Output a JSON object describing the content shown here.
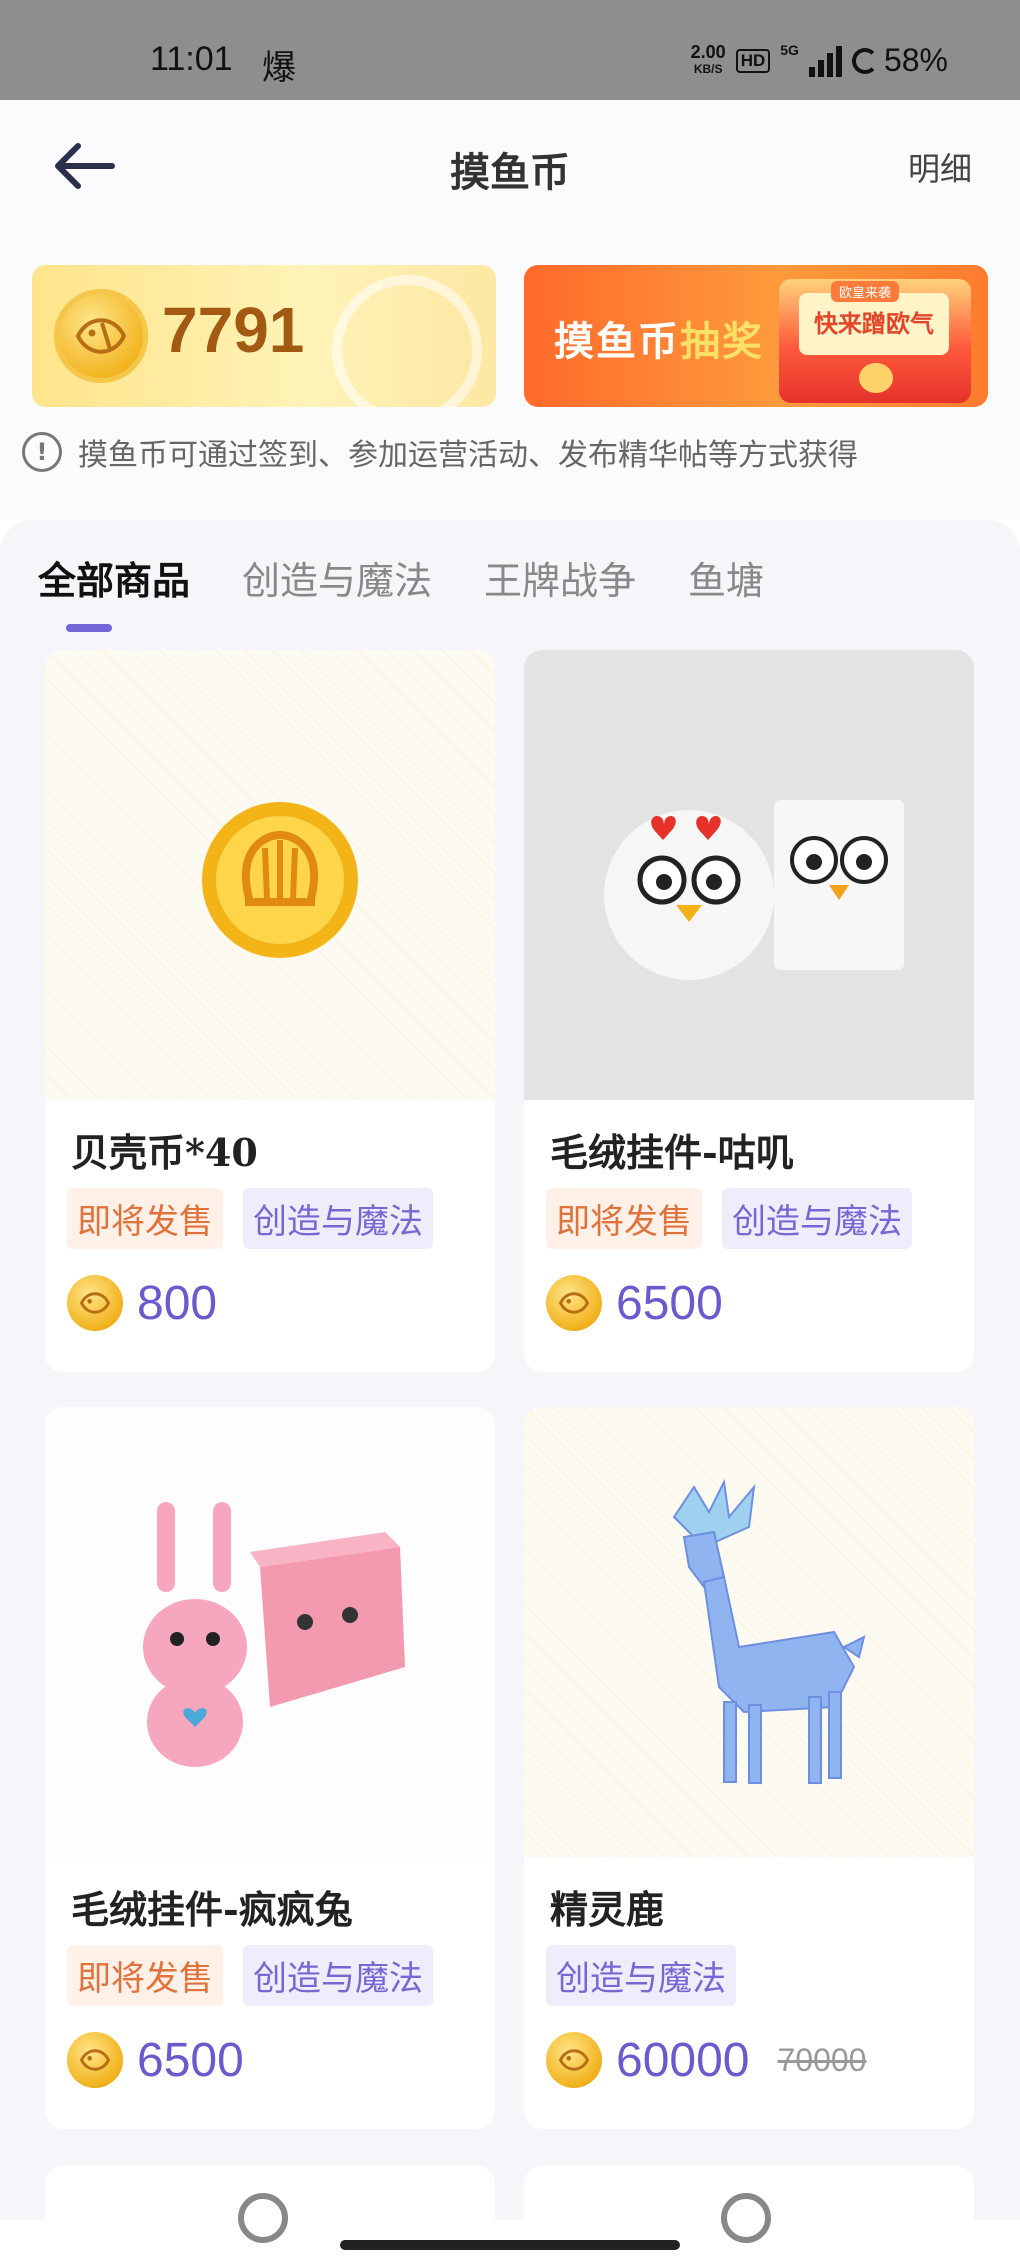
{
  "status_bar": {
    "time": "11:01",
    "notif_glyph": "爆",
    "speed_value": "2.00",
    "speed_unit": "KB/S",
    "hd": "HD",
    "network": "5G",
    "battery": "58%"
  },
  "header": {
    "title": "摸鱼币",
    "detail_label": "明细"
  },
  "balance_banner": {
    "balance": "7791"
  },
  "lottery_banner": {
    "text_part1": "摸鱼币",
    "text_part2": "抽奖",
    "card_text": "快来蹭欧气",
    "badge": "欧皇来袭"
  },
  "tip": {
    "text": "摸鱼币可通过签到、参加运营活动、发布精华帖等方式获得"
  },
  "tabs": [
    {
      "label": "全部商品",
      "active": true
    },
    {
      "label": "创造与魔法",
      "active": false
    },
    {
      "label": "王牌战争",
      "active": false
    },
    {
      "label": "鱼塘",
      "active": false
    }
  ],
  "products": [
    {
      "name": "贝壳币*40",
      "tags": [
        "即将发售",
        "创造与魔法"
      ],
      "price": "800",
      "old_price": ""
    },
    {
      "name": "毛绒挂件-咕叽",
      "tags": [
        "即将发售",
        "创造与魔法"
      ],
      "price": "6500",
      "old_price": ""
    },
    {
      "name": "毛绒挂件-疯疯兔",
      "tags": [
        "即将发售",
        "创造与魔法"
      ],
      "price": "6500",
      "old_price": ""
    },
    {
      "name": "精灵鹿",
      "tags": [
        "创造与魔法"
      ],
      "price": "60000",
      "old_price": "70000"
    }
  ],
  "colors": {
    "accent": "#7367d8",
    "price": "#6a5acd",
    "tag_orange": "#e0723c",
    "tag_purple": "#7767d2"
  }
}
